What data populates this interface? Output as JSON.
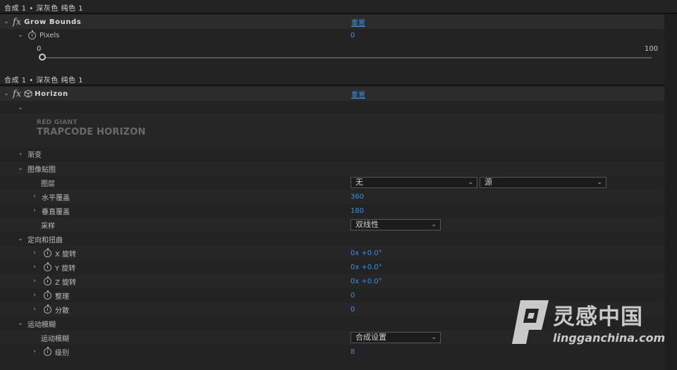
{
  "layer_header_1": "合成 1 • 深灰色 纯色 1",
  "grow_bounds": {
    "title": "Grow Bounds",
    "reset": "重置",
    "pixels_label": "Pixels",
    "pixels_value": "0",
    "slider_min": "0",
    "slider_max": "100"
  },
  "layer_header_2": "合成 1 • 深灰色 纯色 1",
  "horizon": {
    "title": "Horizon",
    "reset": "重置",
    "logo_small": "RED GIANT",
    "logo_big": "TRAPCODE HORIZON",
    "gradient": "渐变",
    "image_map": "图像贴图",
    "layer_label": "图层",
    "layer_value": "无",
    "source_value": "源",
    "h_tile_label": "水平覆盖",
    "h_tile_value": "360",
    "v_tile_label": "垂直覆盖",
    "v_tile_value": "180",
    "sampling_label": "采样",
    "sampling_value": "双线性",
    "orient_group": "定向和扭曲",
    "x_rot_label": "X 旋转",
    "x_rot_value": "0x +0.0°",
    "y_rot_label": "Y 旋转",
    "y_rot_value": "0x +0.0°",
    "z_rot_label": "Z 旋转",
    "z_rot_value": "0x +0.0°",
    "warp_label": "整理",
    "warp_value": "0",
    "scatter_label": "分散",
    "scatter_value": "0",
    "motion_blur_group": "运动模糊",
    "motion_blur_label": "运动模糊",
    "motion_blur_value": "合成设置",
    "level_label": "级别",
    "level_value": "8"
  },
  "watermark": {
    "title": "灵感中国",
    "subtitle": "lingganchina.com"
  }
}
